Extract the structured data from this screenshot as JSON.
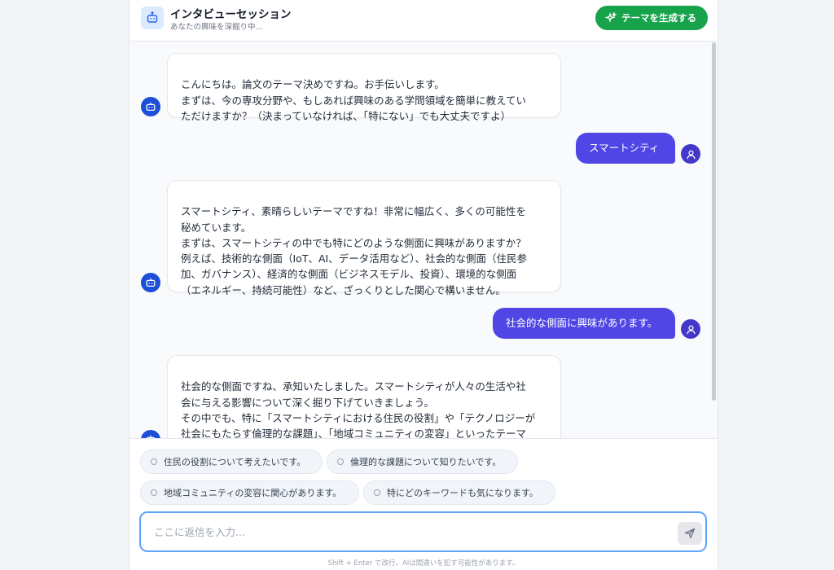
{
  "header": {
    "title": "インタビューセッション",
    "subtitle": "あなたの興味を深掘り中...",
    "generate_button": "テーマを生成する",
    "icon": "robot-icon"
  },
  "messages": [
    {
      "role": "bot",
      "text": "こんにちは。論文のテーマ決めですね。お手伝いします。\nまずは、今の専攻分野や、もしあれば興味のある学問領域を簡単に教えてい\nただけますか？（決まっていなければ、「特にない」でも大丈夫ですよ）"
    },
    {
      "role": "user",
      "text": "スマートシティ"
    },
    {
      "role": "bot",
      "text": "スマートシティ、素晴らしいテーマですね！非常に幅広く、多くの可能性を\n秘めています。\nまずは、スマートシティの中でも特にどのような側面に興味がありますか？\n例えば、技術的な側面（IoT、AI、データ活用など）、社会的な側面（住民参\n加、ガバナンス）、経済的な側面（ビジネスモデル、投資）、環境的な側面\n（エネルギー、持続可能性）など、ざっくりとした関心で構いません。"
    },
    {
      "role": "user",
      "text": "社会的な側面に興味があります。"
    },
    {
      "role": "bot",
      "text": "社会的な側面ですね、承知いたしました。スマートシティが人々の生活や社\n会に与える影響について深く掘り下げていきましょう。\nその中でも、特に「スマートシティにおける住民の役割」や「テクノロジーが\n社会にもたらす倫理的な課題」、「地域コミュニティの変容」といったテーマ\nの中で、現時点で何か気になるキーワードはありますか？"
    }
  ],
  "suggestions": [
    "住民の役割について考えたいです。",
    "倫理的な課題について知りたいです。",
    "地域コミュニティの変容に関心があります。",
    "特にどのキーワードも気になります。"
  ],
  "input": {
    "placeholder": "ここに返信を入力...",
    "value": ""
  },
  "footnote": "Shift + Enter で改行。AIは間違いを犯す可能性があります。",
  "colors": {
    "accent_green": "#16a34a",
    "user_bubble": "#4f46e5",
    "bot_avatar": "#1d4ed8",
    "input_focus": "#60a5fa"
  }
}
